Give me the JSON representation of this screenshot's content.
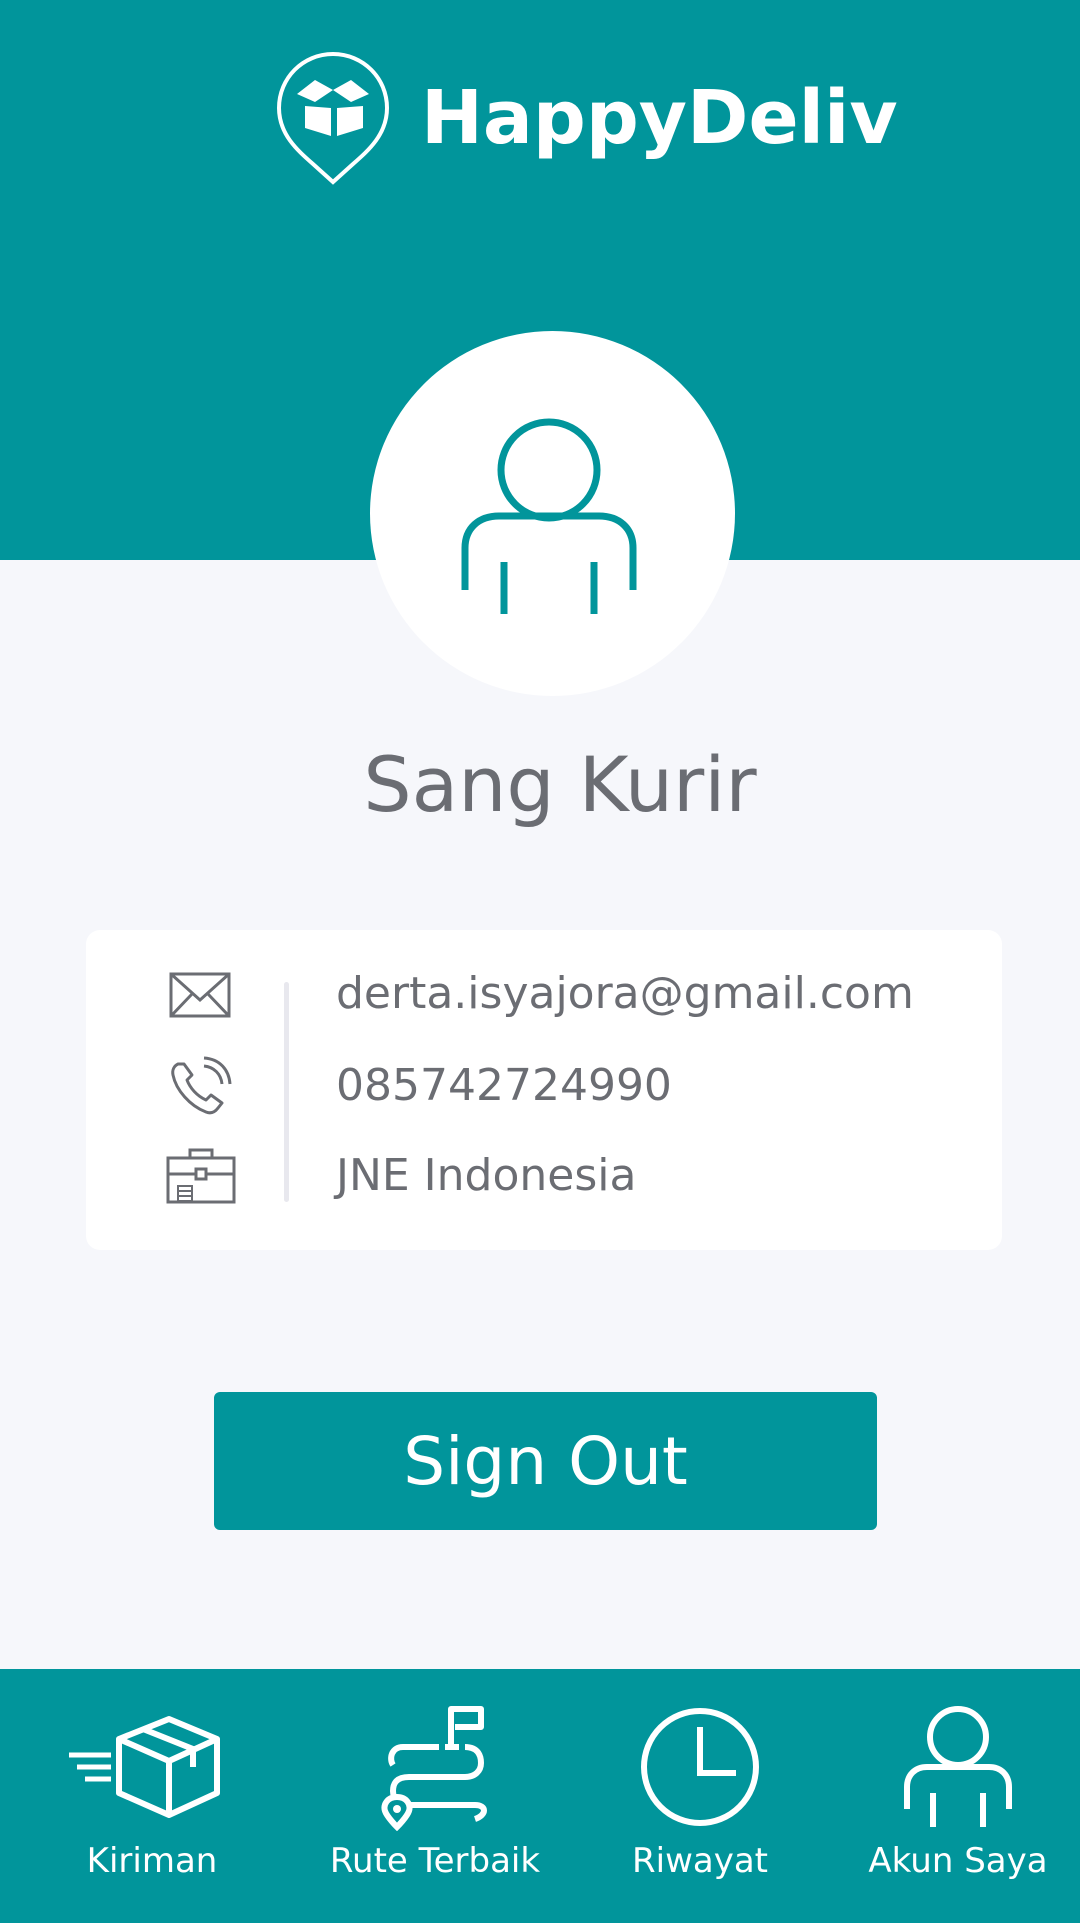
{
  "app": {
    "name": "HappyDeliv"
  },
  "profile": {
    "name": "Sang Kurir"
  },
  "info": {
    "email": "derta.isyajora@gmail.com",
    "phone": "085742724990",
    "company": "JNE Indonesia"
  },
  "actions": {
    "sign_out_label": "Sign Out"
  },
  "nav": {
    "items": [
      {
        "label": "Kiriman",
        "icon": "package-icon"
      },
      {
        "label": "Rute Terbaik",
        "icon": "route-icon"
      },
      {
        "label": "Riwayat",
        "icon": "clock-icon"
      },
      {
        "label": "Akun Saya",
        "icon": "user-icon"
      }
    ]
  },
  "colors": {
    "primary": "#01959b",
    "background": "#f6f7fb",
    "text": "#6b6d73"
  }
}
